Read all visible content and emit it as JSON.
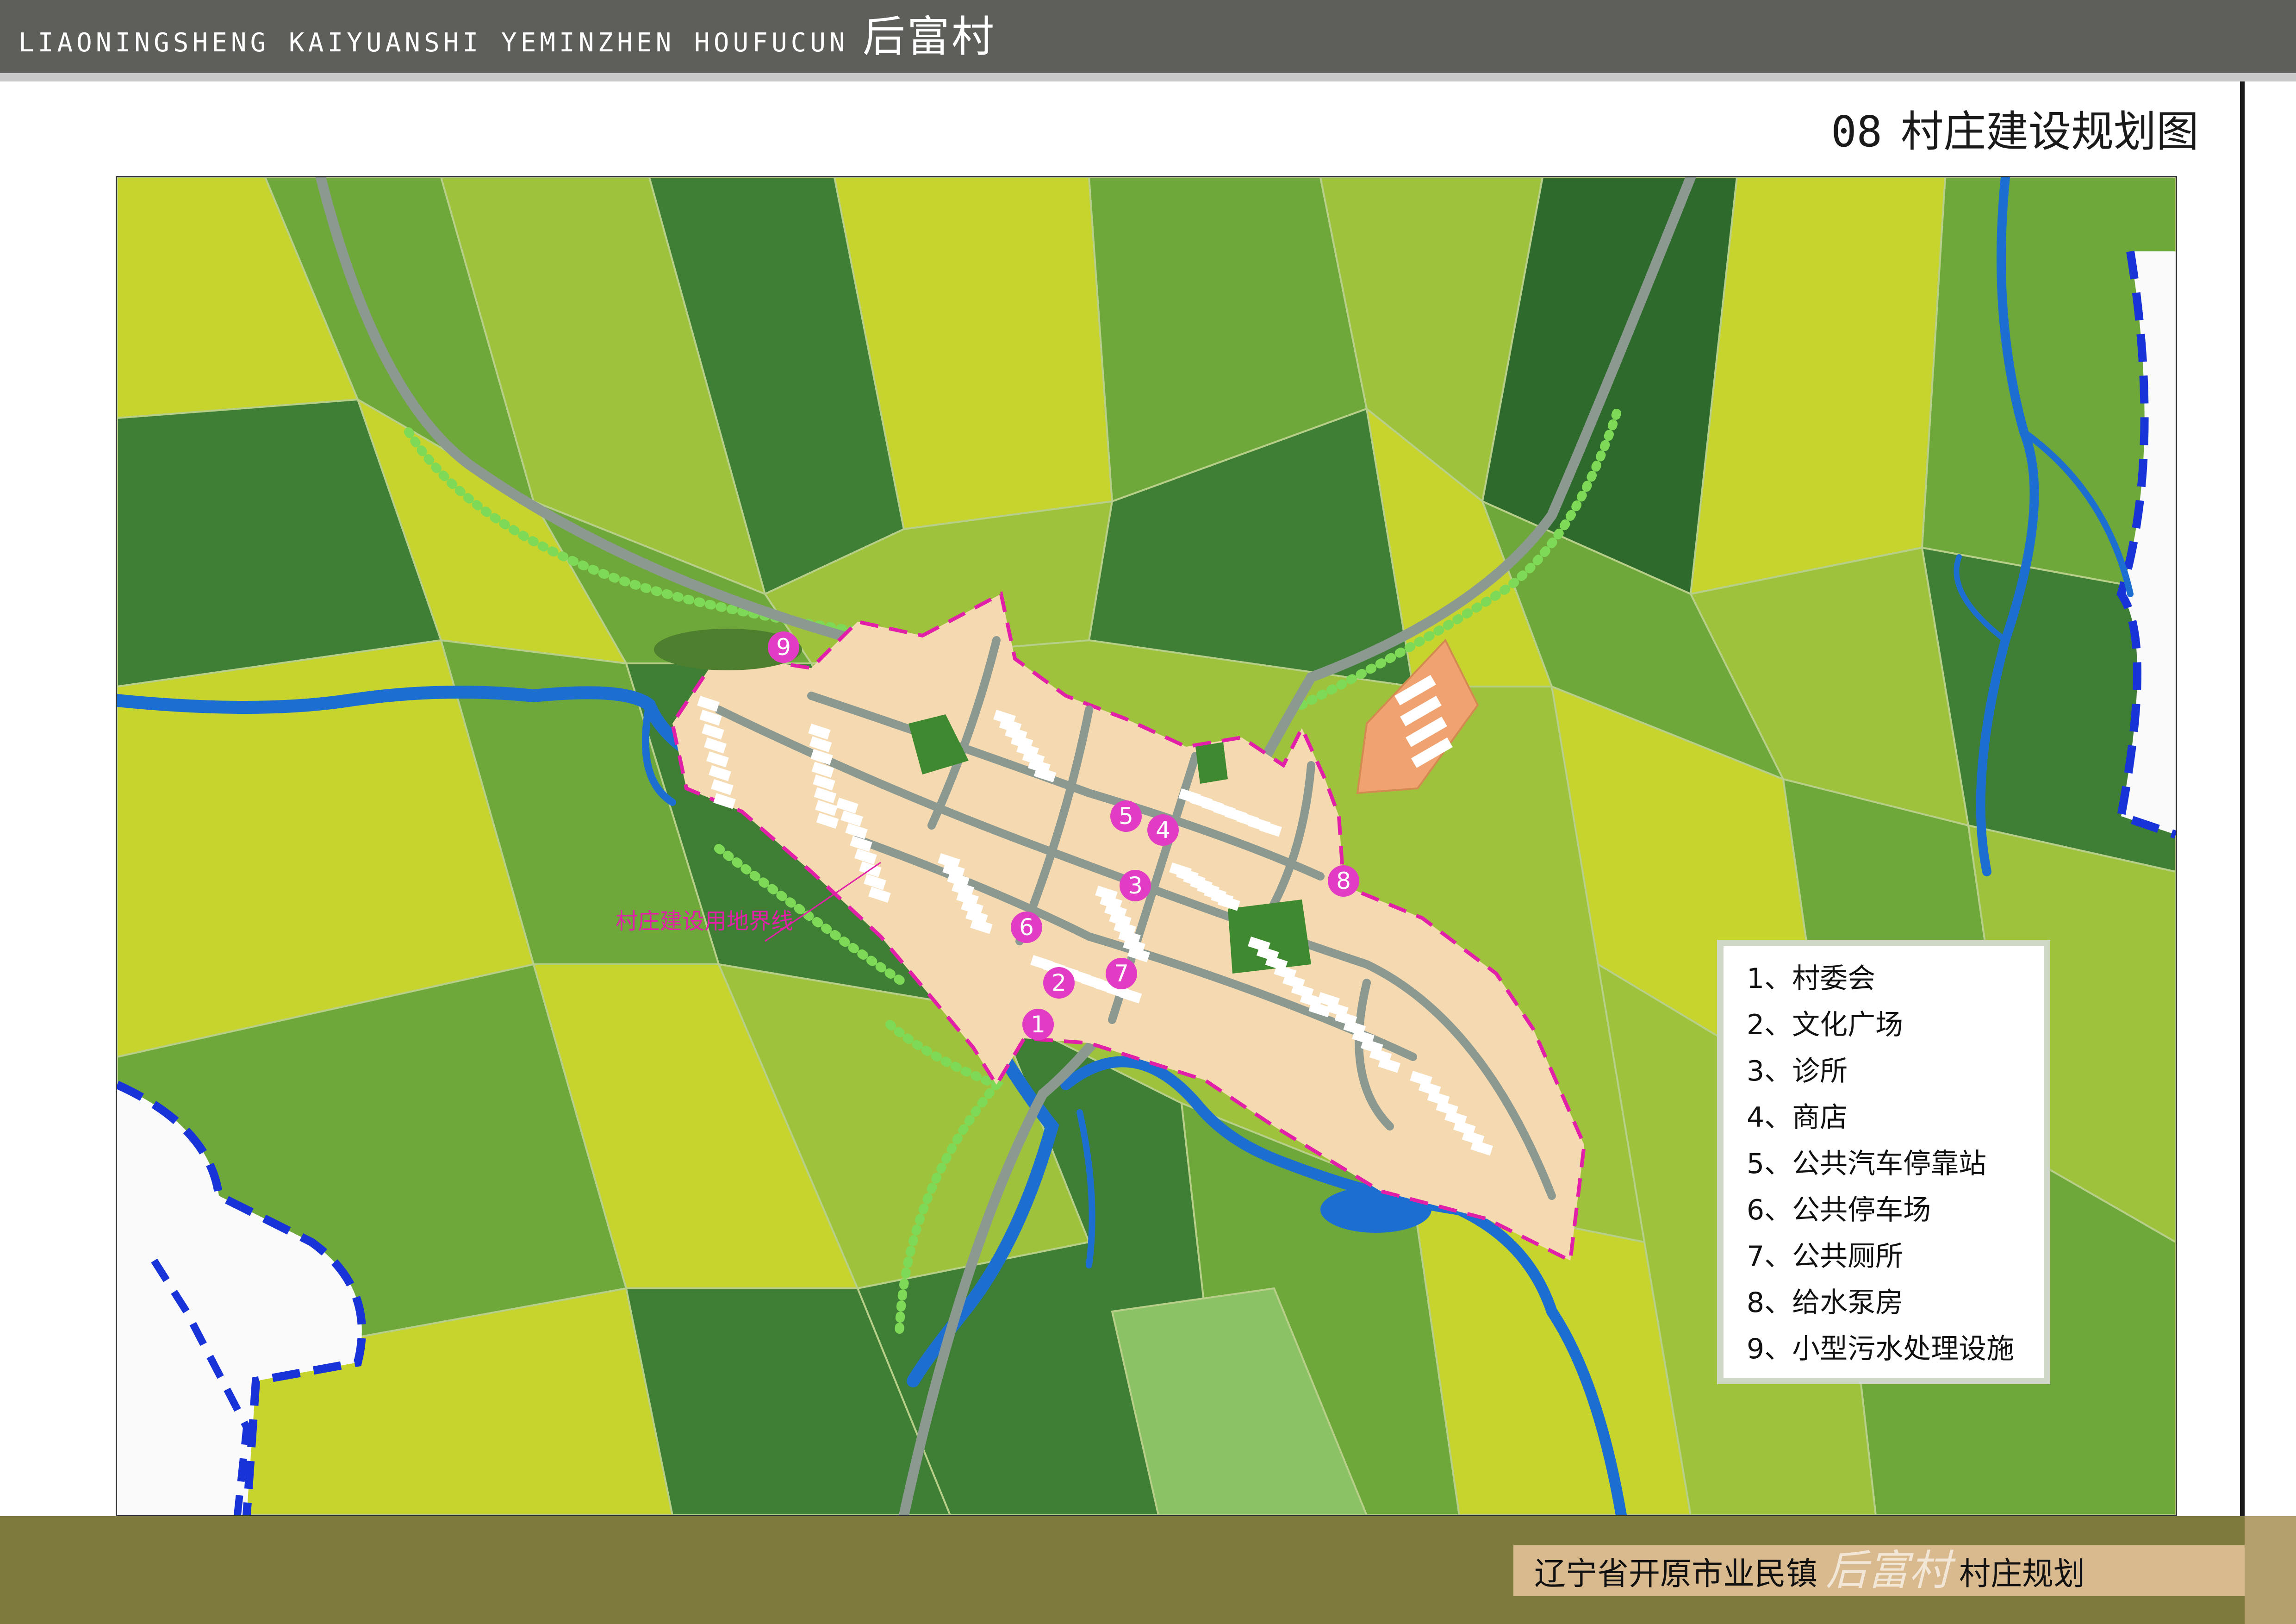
{
  "header": {
    "pinyin": "LIAONINGSHENG KAIYUANSHI YEMINZHEN HOUFUCUN",
    "village": "后富村"
  },
  "page_title": {
    "number": "08",
    "text": "村庄建设规划图"
  },
  "map": {
    "boundary_label": "村庄建设用地界线",
    "markers": [
      "1",
      "2",
      "3",
      "4",
      "5",
      "6",
      "7",
      "8",
      "9"
    ],
    "colors": {
      "field_light": "#c7d42e",
      "field_mid": "#9fc23c",
      "field_green": "#6fa83a",
      "field_dark": "#3f7f35",
      "field_darkest": "#2f6a2d",
      "village": "#f5d9b0",
      "water": "#1c6fd1",
      "road": "#8c9990",
      "boundary": "#e21fa8",
      "marker": "#e23bc4",
      "admin_boundary": "#1833d8"
    }
  },
  "legend": {
    "items": [
      "1、村委会",
      "2、文化广场",
      "3、诊所",
      "4、商店",
      "5、公共汽车停靠站",
      "6、公共停车场",
      "7、公共厕所",
      "8、给水泵房",
      "9、小型污水处理设施"
    ]
  },
  "footer": {
    "prefix": "辽宁省开原市业民镇",
    "village": "后富村",
    "suffix": "村庄规划"
  }
}
